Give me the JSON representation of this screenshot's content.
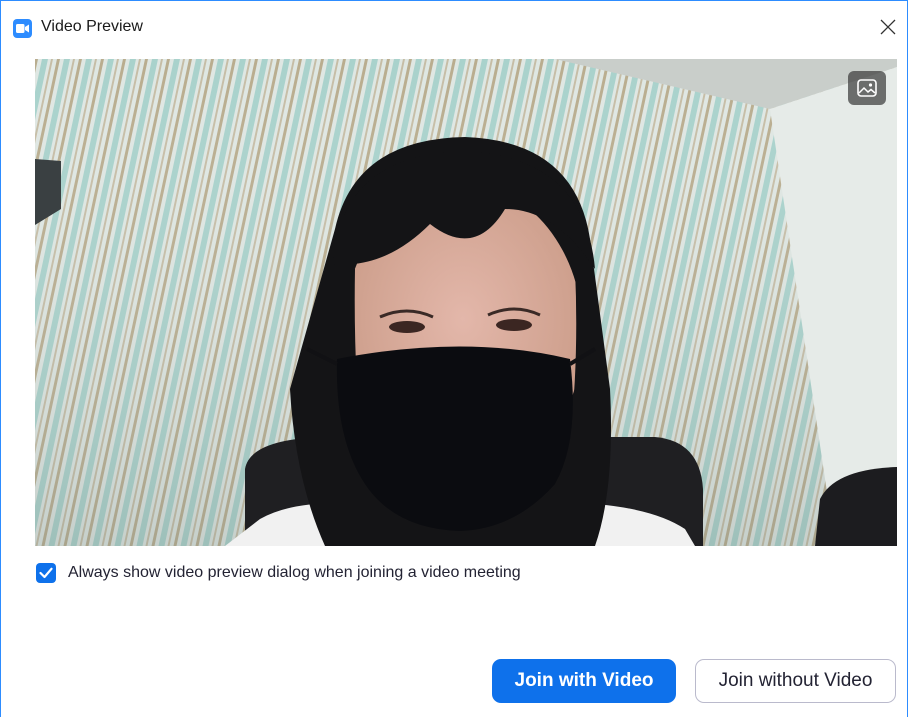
{
  "window": {
    "title": "Video Preview",
    "accent_color": "#2d8cff",
    "icon": "zoom-camera-icon",
    "close_icon": "close-icon"
  },
  "video": {
    "background_button_icon": "virtual-background-icon"
  },
  "options": {
    "always_show_label": "Always show video preview dialog when joining a video meeting",
    "always_show_checked": true
  },
  "buttons": {
    "join_with_video": "Join with Video",
    "join_without_video": "Join without Video",
    "primary_color": "#0e71eb"
  }
}
